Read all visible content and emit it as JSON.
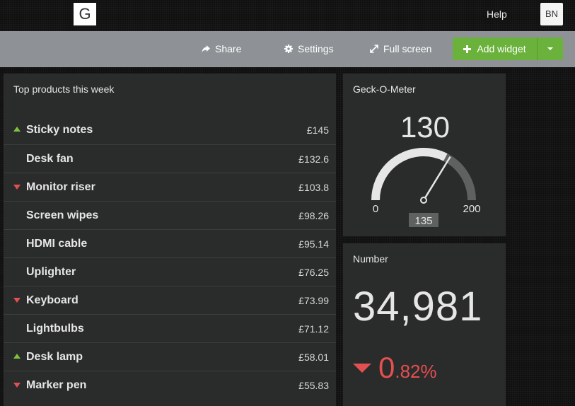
{
  "header": {
    "logo_letter": "G",
    "help_label": "Help",
    "avatar_initials": "BN"
  },
  "toolbar": {
    "share_label": "Share",
    "settings_label": "Settings",
    "fullscreen_label": "Full screen",
    "add_widget_label": "Add widget"
  },
  "leaderboard": {
    "title": "Top products this week",
    "rows": [
      {
        "name": "Sticky notes",
        "value": "£145",
        "trend": "up"
      },
      {
        "name": "Desk fan",
        "value": "£132.6",
        "trend": "none"
      },
      {
        "name": "Monitor riser",
        "value": "£103.8",
        "trend": "down"
      },
      {
        "name": "Screen wipes",
        "value": "£98.26",
        "trend": "none"
      },
      {
        "name": "HDMI cable",
        "value": "£95.14",
        "trend": "none"
      },
      {
        "name": "Uplighter",
        "value": "£76.25",
        "trend": "none"
      },
      {
        "name": "Keyboard",
        "value": "£73.99",
        "trend": "down"
      },
      {
        "name": "Lightbulbs",
        "value": "£71.12",
        "trend": "none"
      },
      {
        "name": "Desk lamp",
        "value": "£58.01",
        "trend": "up"
      },
      {
        "name": "Marker pen",
        "value": "£55.83",
        "trend": "down"
      }
    ]
  },
  "gauge": {
    "title": "Geck-O-Meter",
    "value": "130",
    "min": "0",
    "max": "200",
    "target": "135",
    "value_num": 130,
    "min_num": 0,
    "max_num": 200,
    "target_num": 135
  },
  "number_widget": {
    "title": "Number",
    "value": "34,981",
    "change_int": "0",
    "change_dec": ".82%",
    "trend": "down"
  },
  "colors": {
    "accent_green": "#6ab23b",
    "up": "#7fc23f",
    "down": "#e44f4f",
    "toolbar": "#8e9296",
    "widget_bg": "#2a2b2b"
  }
}
